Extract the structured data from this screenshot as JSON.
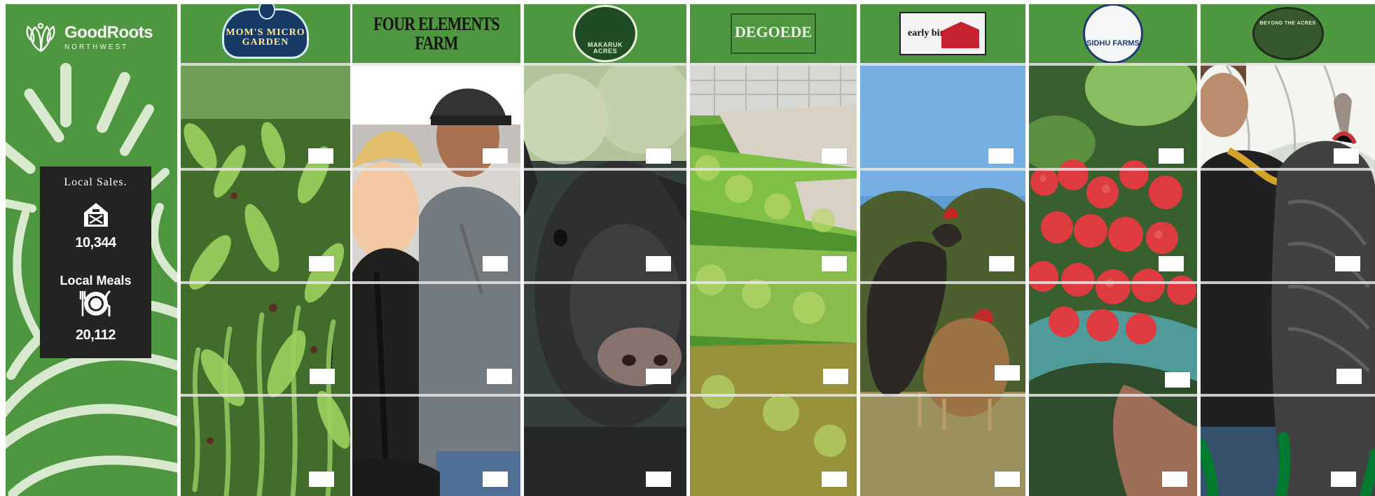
{
  "brand": {
    "name": "GoodRoots",
    "sub": "NORTHWEST",
    "icon": "goodroots-leaf-logo-icon"
  },
  "stats": {
    "title": "Local Sales.",
    "sales_icon": "barn-icon",
    "sales_value": "10,344",
    "meals_label": "Local Meals",
    "meals_icon": "plate-utensils-icon",
    "meals_value": "20,112"
  },
  "farms": [
    {
      "id": "moms-micro-garden",
      "logo_text": "MOM'S MICRO GARDEN",
      "logo_icon": "farm-logo-icon",
      "photo_subject": "micro-garden-plants-photo"
    },
    {
      "id": "four-elements-farm",
      "logo_text": "FOUR ELEMENTS FARM",
      "logo_icon": "farm-logo-icon",
      "photo_subject": "farmers-portrait-photo"
    },
    {
      "id": "makaruk-acres",
      "logo_text": "MAKARUK ACRES",
      "logo_icon": "farm-logo-icon",
      "photo_subject": "pig-photo"
    },
    {
      "id": "degoede-farms",
      "logo_text": "DEGOEDE",
      "logo_icon": "farm-logo-icon",
      "photo_subject": "greenhouse-lettuce-photo"
    },
    {
      "id": "early-bird-farm",
      "logo_text": "early bird farm",
      "logo_icon": "farm-logo-icon",
      "photo_subject": "chickens-photo"
    },
    {
      "id": "sidhu-farms",
      "logo_text": "SIDHU FARMS",
      "logo_icon": "farm-logo-icon",
      "photo_subject": "raspberries-photo"
    },
    {
      "id": "beyond-the-acres",
      "logo_text": "BEYOND THE ACRES",
      "logo_icon": "farm-logo-icon",
      "photo_subject": "turkey-and-farmer-photo"
    }
  ],
  "colors": {
    "brand_green": "#4f9640",
    "panel_dark": "#232323",
    "white": "#ffffff"
  }
}
